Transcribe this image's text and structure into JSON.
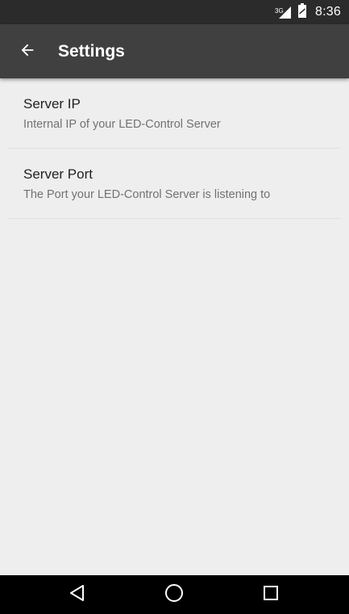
{
  "status_bar": {
    "network_type": "3G",
    "time": "8:36",
    "icons": [
      "signal-icon",
      "battery-icon"
    ]
  },
  "app_bar": {
    "title": "Settings",
    "back_icon": "arrow-back-icon"
  },
  "preferences": [
    {
      "title": "Server IP",
      "summary": "Internal IP of your LED-Control Server"
    },
    {
      "title": "Server Port",
      "summary": "The Port your LED-Control Server is listening to"
    }
  ],
  "nav_bar": {
    "icons": [
      "back-triangle-icon",
      "home-circle-icon",
      "recents-square-icon"
    ]
  },
  "colors": {
    "status_bar": "#2b2b2b",
    "app_bar": "#404040",
    "background": "#eeeeee",
    "nav_bar": "#000000"
  }
}
